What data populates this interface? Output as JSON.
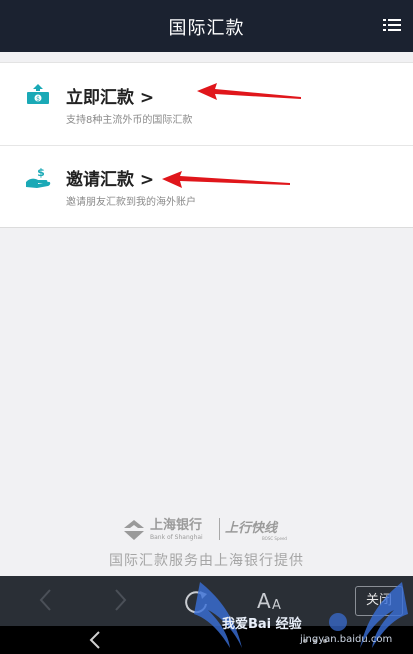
{
  "header": {
    "title": "国际汇款",
    "menu_icon": "list-icon"
  },
  "items": [
    {
      "label": "立即汇款 >",
      "sub": "支持8种主流外币的国际汇款",
      "icon": "money-transfer-icon",
      "color": "#1aa9b6"
    },
    {
      "label": "邀请汇款 >",
      "sub": "邀请朋友汇款到我的海外账户",
      "icon": "hand-money-icon",
      "color": "#1aa9b6"
    }
  ],
  "annotation_color": "#e0161b",
  "brand": {
    "logo_cn": "上海银行",
    "logo_en": "Bank of Shanghai",
    "product": "上行快线",
    "product_en": "BOSC Speed"
  },
  "footer": {
    "text": "国际汇款服务由上海银行提供"
  },
  "toolbar": {
    "close_label": "关闭",
    "icons": [
      "back-icon",
      "forward-icon",
      "refresh-icon",
      "font-size-icon"
    ]
  },
  "watermark": {
    "text": "我爱Bai 经验",
    "url": "jingyan.baidu.com"
  }
}
